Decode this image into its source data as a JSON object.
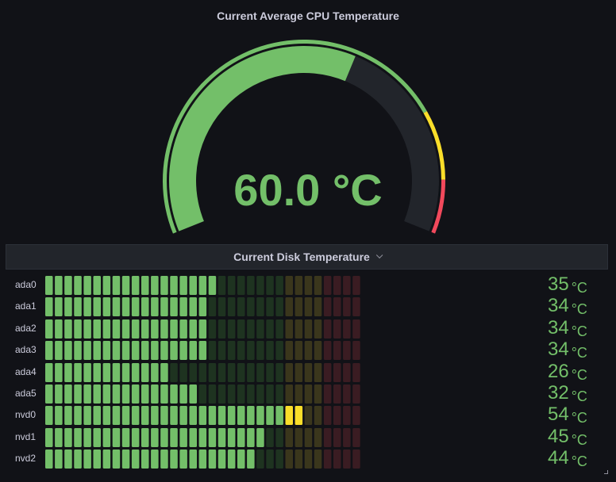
{
  "gauge_panel": {
    "title": "Current Average CPU Temperature",
    "value": 60.0,
    "display_value": "60.0 °C",
    "min": 0,
    "max": 100,
    "thresholds": [
      {
        "from": 0,
        "to": 77,
        "color": "#73bf69"
      },
      {
        "from": 77,
        "to": 90,
        "color": "#fade2a"
      },
      {
        "from": 90,
        "to": 100,
        "color": "#f2495c"
      }
    ],
    "fill_color": "#73bf69",
    "track_color": "#22252b"
  },
  "disk_panel": {
    "title": "Current Disk Temperature",
    "unit": "°C",
    "min": 0,
    "max": 66,
    "segments": 33,
    "zones": [
      {
        "from": 0,
        "to": 51,
        "lit": "#73bf69",
        "dim": "#1e3320"
      },
      {
        "from": 51,
        "to": 59,
        "lit": "#fade2a",
        "dim": "#3a361c"
      },
      {
        "from": 59,
        "to": 66,
        "lit": "#f2495c",
        "dim": "#3a1c22"
      }
    ],
    "disks": [
      {
        "name": "ada0",
        "value": 35,
        "display": "35"
      },
      {
        "name": "ada1",
        "value": 34,
        "display": "34"
      },
      {
        "name": "ada2",
        "value": 34,
        "display": "34"
      },
      {
        "name": "ada3",
        "value": 34,
        "display": "34"
      },
      {
        "name": "ada4",
        "value": 26,
        "display": "26"
      },
      {
        "name": "ada5",
        "value": 32,
        "display": "32"
      },
      {
        "name": "nvd0",
        "value": 54,
        "display": "54"
      },
      {
        "name": "nvd1",
        "value": 45,
        "display": "45"
      },
      {
        "name": "nvd2",
        "value": 44,
        "display": "44"
      }
    ]
  }
}
